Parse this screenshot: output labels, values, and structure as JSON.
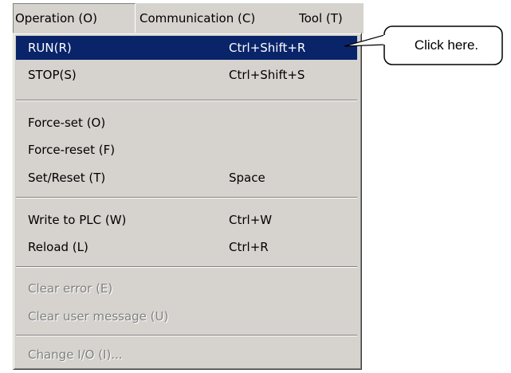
{
  "menubar": {
    "items": [
      {
        "label": "Operation (O)"
      },
      {
        "label": "Communication (C)"
      },
      {
        "label": "Tool (T)"
      }
    ]
  },
  "dropdown": {
    "items": [
      {
        "label": "RUN(R)",
        "shortcut": "Ctrl+Shift+R",
        "state": "selected"
      },
      {
        "label": "STOP(S)",
        "shortcut": "Ctrl+Shift+S",
        "state": "enabled"
      },
      {
        "label": "Force-set (O)",
        "shortcut": "",
        "state": "enabled"
      },
      {
        "label": "Force-reset (F)",
        "shortcut": "",
        "state": "enabled"
      },
      {
        "label": "Set/Reset (T)",
        "shortcut": "Space",
        "state": "enabled"
      },
      {
        "label": "Write to PLC (W)",
        "shortcut": "Ctrl+W",
        "state": "enabled"
      },
      {
        "label": "Reload (L)",
        "shortcut": "Ctrl+R",
        "state": "enabled"
      },
      {
        "label": "Clear error (E)",
        "shortcut": "",
        "state": "disabled"
      },
      {
        "label": "Clear user message (U)",
        "shortcut": "",
        "state": "disabled"
      },
      {
        "label": "Change I/O (I)...",
        "shortcut": "",
        "state": "disabled"
      }
    ]
  },
  "callout": {
    "text": "Click here."
  },
  "colors": {
    "menu_face": "#d6d3ce",
    "highlight": "#0a246a",
    "disabled_text": "#808080"
  }
}
